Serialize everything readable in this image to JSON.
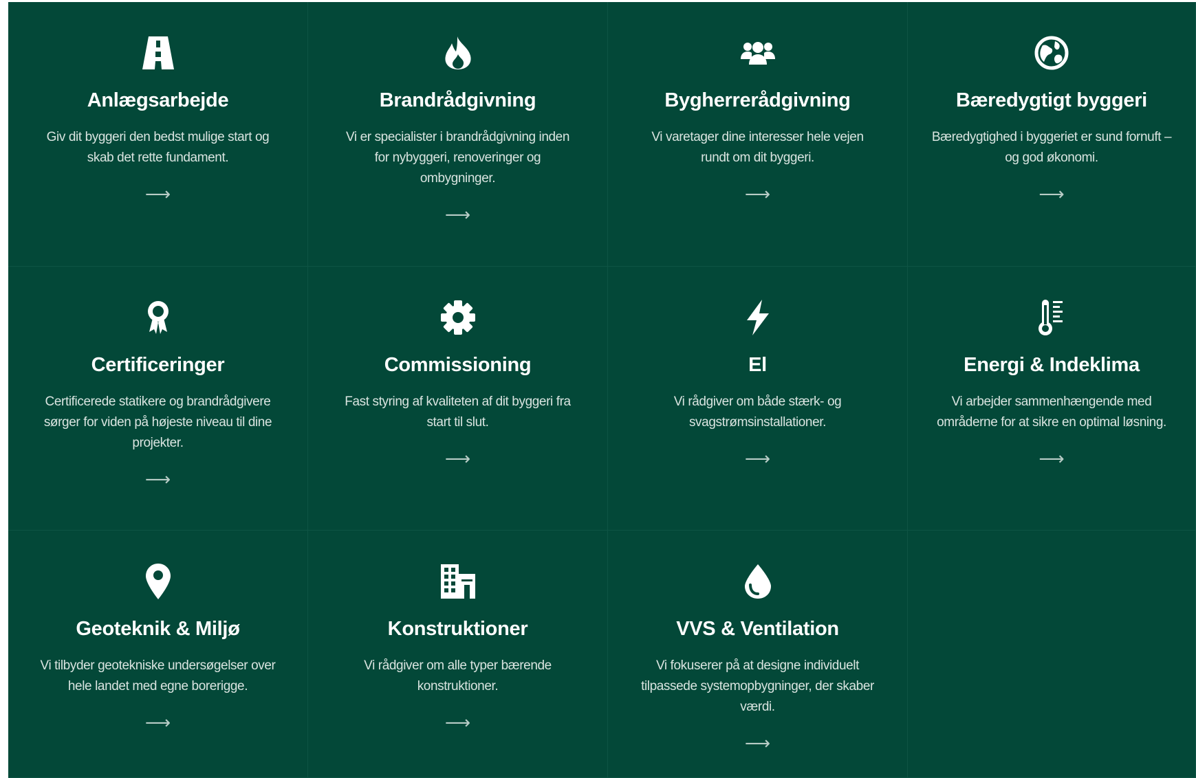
{
  "arrow_glyph": "⟶",
  "colors": {
    "background": "#034838",
    "divider": "#0e5444",
    "title": "#ffffff",
    "description": "#d9e4e0"
  },
  "services": [
    {
      "icon": "road-icon",
      "title": "Anlægsarbejde",
      "description": "Giv dit byggeri den bedst mulige start og skab det rette fundament."
    },
    {
      "icon": "fire-icon",
      "title": "Brandrådgivning",
      "description": "Vi er specialister i brandrådgivning inden for nybyggeri, renoveringer og ombygninger."
    },
    {
      "icon": "users-icon",
      "title": "Bygherrerådgivning",
      "description": "Vi varetager dine interesser hele vejen rundt om dit byggeri."
    },
    {
      "icon": "globe-icon",
      "title": "Bæredygtigt byggeri",
      "description": "Bæredygtighed i byggeriet er sund fornuft – og god økonomi."
    },
    {
      "icon": "award-icon",
      "title": "Certificeringer",
      "description": "Certificerede statikere og brandrådgivere sørger for viden på højeste niveau til dine projekter."
    },
    {
      "icon": "gear-icon",
      "title": "Commissioning",
      "description": "Fast styring af kvaliteten af dit byggeri fra start til slut."
    },
    {
      "icon": "bolt-icon",
      "title": "El",
      "description": "Vi rådgiver om både stærk- og svagstrømsinstallationer."
    },
    {
      "icon": "thermometer-icon",
      "title": "Energi & Indeklima",
      "description": "Vi arbejder sammenhængende med områderne for at sikre en optimal løsning."
    },
    {
      "icon": "map-pin-icon",
      "title": "Geoteknik & Miljø",
      "description": "Vi tilbyder geotekniske undersøgelser over hele landet med egne borerigge."
    },
    {
      "icon": "building-icon",
      "title": "Konstruktioner",
      "description": "Vi rådgiver om alle typer bærende konstruktioner."
    },
    {
      "icon": "water-drop-icon",
      "title": "VVS & Ventilation",
      "description": "Vi fokuserer på at designe individuelt tilpassede systemopbygninger, der skaber værdi."
    }
  ]
}
